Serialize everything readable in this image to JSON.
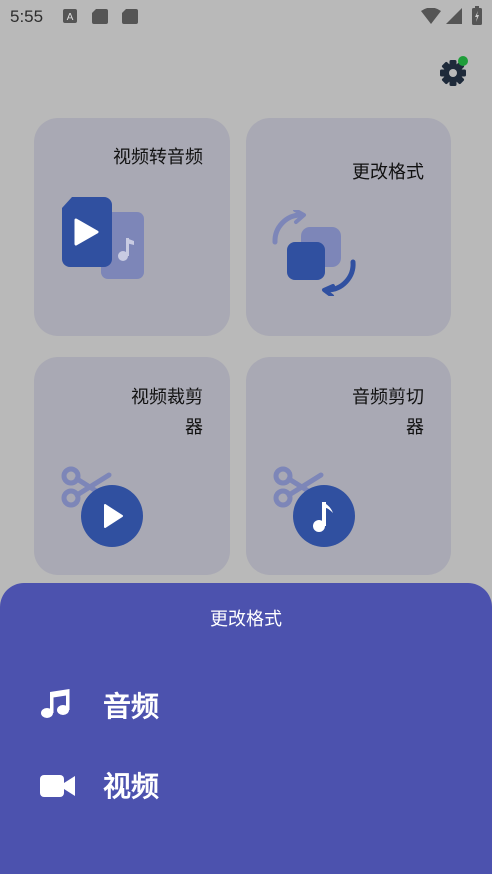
{
  "status_bar": {
    "time": "5:55",
    "icons": [
      "a-notification-icon",
      "sd-card-icon",
      "sd-card-icon",
      "wifi-icon",
      "signal-icon",
      "battery-icon"
    ]
  },
  "header": {
    "settings_icon": "gear-icon",
    "badge_color": "#1f9d3a"
  },
  "cards": [
    {
      "label": "视频转音频",
      "icon": "video-to-audio-icon"
    },
    {
      "label": "更改格式",
      "icon": "convert-format-icon"
    },
    {
      "label_lines": [
        "视频裁剪",
        "器"
      ],
      "icon": "video-trim-icon"
    },
    {
      "label_lines": [
        "音频剪切",
        "器"
      ],
      "icon": "audio-cut-icon"
    }
  ],
  "sheet": {
    "title": "更改格式",
    "options": [
      {
        "label": "音频",
        "icon": "music-note-icon"
      },
      {
        "label": "视频",
        "icon": "video-camera-icon"
      }
    ]
  },
  "colors": {
    "background": "#b9b9b9",
    "card": "#a9a9b4",
    "accent": "#3050a0",
    "accent_light": "#7d86b8",
    "sheet": "#4c52ae"
  }
}
